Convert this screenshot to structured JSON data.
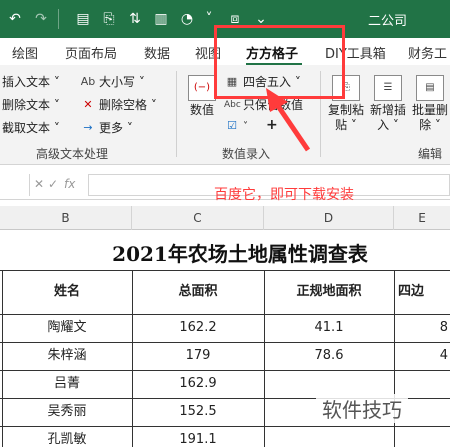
{
  "titlebar": {
    "doc_title": "二公司",
    "icons": [
      "undo-icon",
      "redo-icon",
      "document-icon",
      "format-painter-icon",
      "chart-icon",
      "shapes-icon",
      "layout-icon",
      "dropdown-icon"
    ]
  },
  "tabs": [
    {
      "label": "绘图"
    },
    {
      "label": "页面布局"
    },
    {
      "label": "数据"
    },
    {
      "label": "视图"
    },
    {
      "label": "方方格子",
      "active": true
    },
    {
      "label": "DIY工具箱"
    },
    {
      "label": "财务工"
    }
  ],
  "ribbon": {
    "text_group": {
      "items": [
        "插入文本 ˅",
        "删除文本 ˅",
        "截取文本 ˅"
      ],
      "items2": [
        "大小写 ˅",
        "删除空格 ˅",
        "更多 ˅"
      ],
      "label": "高级文本处理"
    },
    "number_group": {
      "numeric_btn": "数值",
      "round_btn": "四舍五入 ˅",
      "keep_value_btn": "只保留数值",
      "plus": "+",
      "label": "数值录入"
    },
    "edit_group": {
      "buttons": [
        "复制粘贴 ˅",
        "新增插入 ˅",
        "批量删除 ˅"
      ],
      "label": "编辑"
    }
  },
  "formula_bar": {
    "fx": "fx",
    "value": ""
  },
  "annotation": {
    "text": "百度它，即可下载安装",
    "color": "#ff3b3b"
  },
  "columns": [
    "B",
    "C",
    "D",
    "E"
  ],
  "sheet": {
    "title": "2021年农场土地属性调查表",
    "headers": [
      "姓名",
      "总面积",
      "正规地面积",
      "四边"
    ],
    "rows": [
      {
        "name": "陶耀文",
        "total": "162.2",
        "regular": "41.1",
        "edge": "8"
      },
      {
        "name": "朱梓涵",
        "total": "179",
        "regular": "78.6",
        "edge": "4"
      },
      {
        "name": "吕菁",
        "total": "162.9",
        "regular": "",
        "edge": ""
      },
      {
        "name": "吴秀丽",
        "total": "152.5",
        "regular": "",
        "edge": ""
      },
      {
        "name": "孔凯敏",
        "total": "191.1",
        "regular": "",
        "edge": ""
      }
    ]
  },
  "watermark": "软件技巧",
  "colors": {
    "brand": "#217346",
    "annotation": "#ff3b3b"
  }
}
